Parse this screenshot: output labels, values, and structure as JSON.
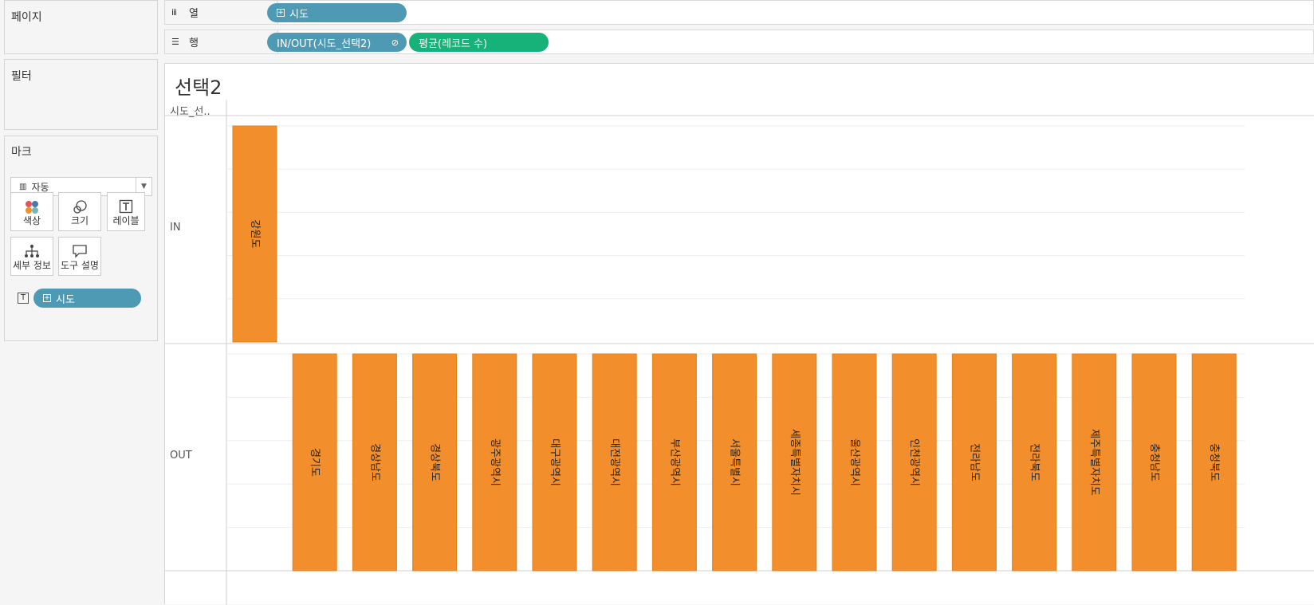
{
  "panels": {
    "pages": "페이지",
    "filters": "필터",
    "marks": "마크"
  },
  "marks": {
    "type_label": "자동",
    "buttons": [
      {
        "label": "색상",
        "icon": "color-icon"
      },
      {
        "label": "크기",
        "icon": "size-icon"
      },
      {
        "label": "레이블",
        "icon": "label-icon"
      },
      {
        "label": "세부 정보",
        "icon": "detail-icon"
      },
      {
        "label": "도구 설명",
        "icon": "tooltip-icon"
      }
    ],
    "label_field": "시도"
  },
  "shelves": {
    "columns_label": "열",
    "rows_label": "행",
    "column_pill": "시도",
    "row_pills": [
      "IN/OUT(시도_선택2)",
      "평균(레코드 수)"
    ]
  },
  "colors": {
    "bar": "#f28e2b",
    "pill_blue": "#4e9ab4",
    "pill_green": "#16b27a"
  },
  "sheet": {
    "title": "선택2",
    "row_header": "시도_선..",
    "rows": [
      "IN",
      "OUT"
    ]
  },
  "chart_data": {
    "type": "bar",
    "panes": [
      {
        "name": "IN",
        "categories": [
          "강원도"
        ],
        "values": [
          1
        ]
      },
      {
        "name": "OUT",
        "categories": [
          "경기도",
          "경상남도",
          "경상북도",
          "광주광역시",
          "대구광역시",
          "대전광역시",
          "부산광역시",
          "서울특별시",
          "세종특별자치시",
          "울산광역시",
          "인천광역시",
          "전라남도",
          "전라북도",
          "제주특별자치도",
          "충청남도",
          "충청북도"
        ],
        "values": [
          1,
          1,
          1,
          1,
          1,
          1,
          1,
          1,
          1,
          1,
          1,
          1,
          1,
          1,
          1,
          1
        ]
      }
    ]
  }
}
